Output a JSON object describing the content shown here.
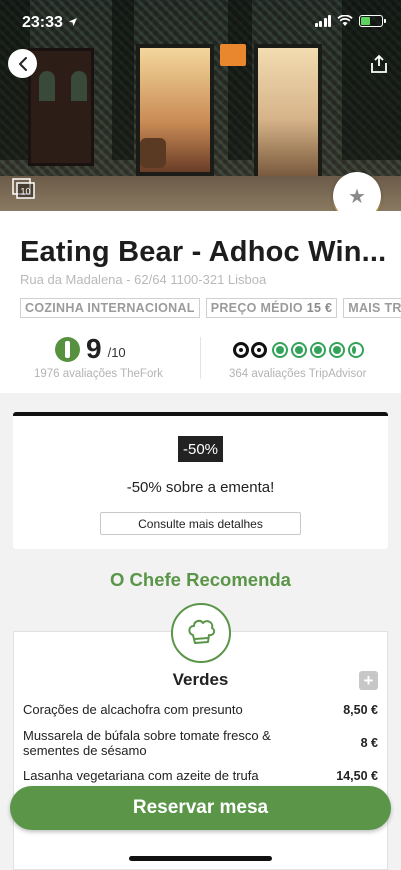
{
  "status_bar": {
    "time": "23:33"
  },
  "restaurant": {
    "name": "Eating Bear - Adhoc Win...",
    "address": "Rua da Madalena - 62/64 1100-321 Lisboa",
    "tags": [
      {
        "label": "COZINHA INTERNACIONAL",
        "value": ""
      },
      {
        "label": "PREÇO MÉDIO",
        "value": "15 €"
      },
      {
        "label": "MAIS TR",
        "value": ""
      }
    ],
    "photo_count": "10"
  },
  "ratings": {
    "thefork_score": "9",
    "thefork_max": "/10",
    "thefork_count": "1976 avaliações TheFork",
    "tripadvisor_bubbles": 4.5,
    "tripadvisor_count": "364 avaliações TripAdvisor"
  },
  "offer": {
    "badge": "-50%",
    "text": "-50% sobre a ementa!",
    "details_button": "Consulte mais detalhes"
  },
  "chef": {
    "title": "O Chefe Recomenda",
    "section": "Verdes",
    "dishes": [
      {
        "name": "Corações de alcachofra com presunto",
        "price": "8,50 €"
      },
      {
        "name": "Mussarela de búfala sobre tomate fresco & sementes de sésamo",
        "price": "8 €"
      },
      {
        "name": "Lasanha vegetariana com azeite de trufa",
        "price": "14,50 €"
      }
    ]
  },
  "cta": {
    "reserve": "Reservar mesa"
  },
  "colors": {
    "accent_green": "#5a9548",
    "tripadvisor_green": "#34a35a"
  }
}
